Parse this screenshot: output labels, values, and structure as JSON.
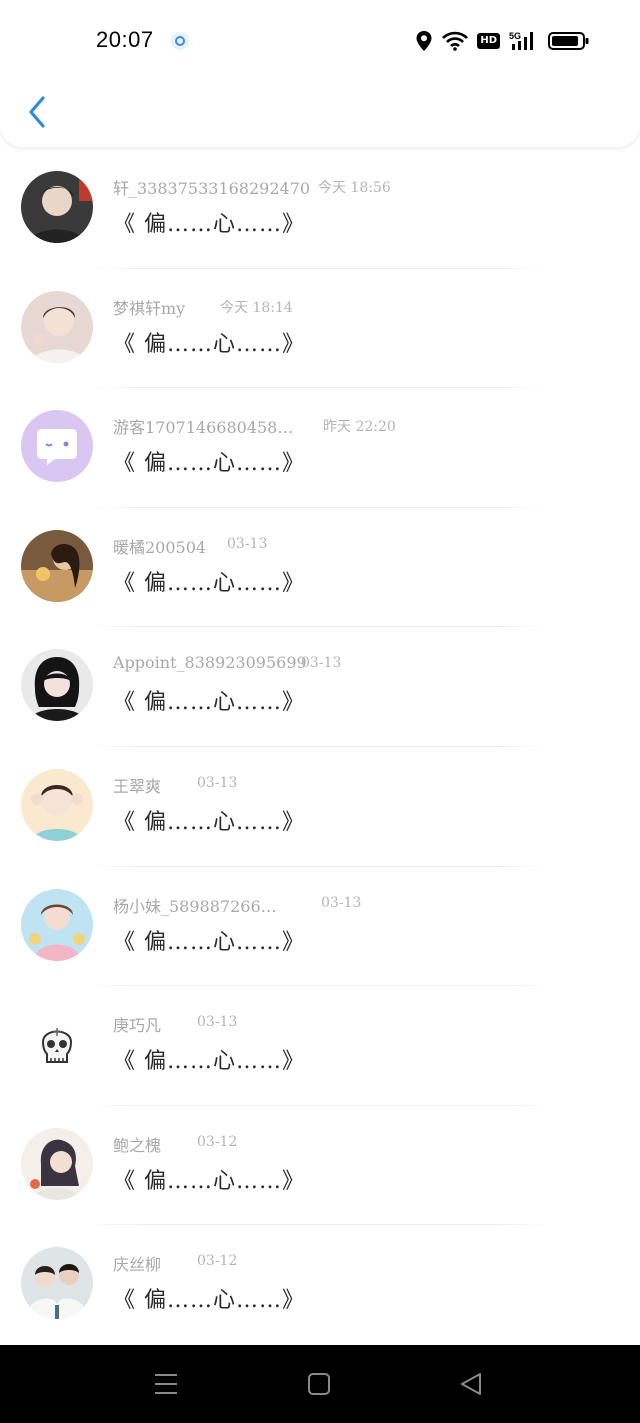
{
  "status_bar": {
    "time": "20:07",
    "network": "5G",
    "hd": "HD"
  },
  "conversations": [
    {
      "name": "轩_3383753316829247​0",
      "time": "今天 18:56",
      "message": "《 偏……心……》",
      "avatar": "avatar-boy-dark"
    },
    {
      "name": "梦祺轩my",
      "time": "今天 18:14",
      "message": "《 偏……心……》",
      "avatar": "avatar-boy-pink"
    },
    {
      "name": "游客1707146680458…",
      "time": "昨天 22:20",
      "message": "《 偏……心……》",
      "avatar": "chat-bubble-icon"
    },
    {
      "name": "暖橘200504",
      "time": "03-13",
      "message": "《 偏……心……》",
      "avatar": "avatar-girl-brown"
    },
    {
      "name": "Appoint_838923095699",
      "time": "03-13",
      "message": "《 偏……心……》",
      "avatar": "avatar-girl-dark"
    },
    {
      "name": "王翠爽",
      "time": "03-13",
      "message": "《 偏……心……》",
      "avatar": "avatar-boy-cream"
    },
    {
      "name": "杨小妹_589887266…",
      "time": "03-13",
      "message": "《 偏……心……》",
      "avatar": "avatar-doll"
    },
    {
      "name": "庚巧凡",
      "time": "03-13",
      "message": "《 偏……心……》",
      "avatar": "skull-icon"
    },
    {
      "name": "鲍之槐",
      "time": "03-12",
      "message": "《 偏……心……》",
      "avatar": "avatar-anime"
    },
    {
      "name": "庆丝柳",
      "time": "03-12",
      "message": "《 偏……心……》",
      "avatar": "avatar-couple"
    }
  ],
  "colors": {
    "accent": "#2f8be0",
    "avatar_purple": "#d9c6f2"
  }
}
